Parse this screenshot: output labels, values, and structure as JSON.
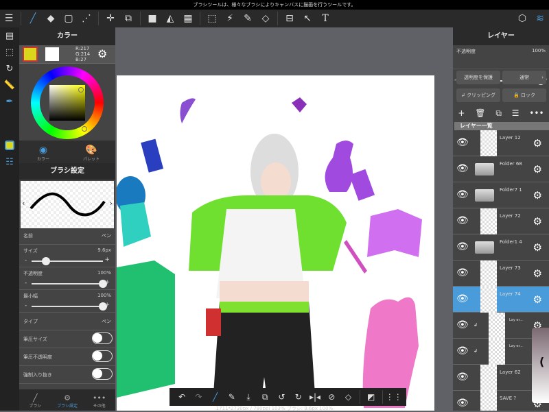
{
  "top_message": "ブラシツールは、様々なブラシによりキャンバスに描画を行うツールです。",
  "toolbar": {
    "icons": [
      "menu-icon",
      "brush-icon",
      "eraser-icon",
      "rectangle-icon",
      "dot-icon",
      "move-icon",
      "transform-icon",
      "fill-color-icon",
      "bucket-icon",
      "gradient-icon",
      "select-icon",
      "magic-wand-icon",
      "select-pen-icon",
      "select-eraser-icon",
      "divide-icon",
      "operation-icon",
      "text-icon"
    ],
    "right_icons": [
      "materials-icon",
      "layers-icon"
    ]
  },
  "color_panel": {
    "title": "カラー",
    "r": "R:217",
    "g": "G:214",
    "b": "B:27",
    "primary": "#d9d61b",
    "tab_color": "カラー",
    "tab_palette": "パレット"
  },
  "brush_settings": {
    "title": "ブラシ設定",
    "name_label": "名前",
    "name_value": "ペン",
    "size_label": "サイズ",
    "size_value": "9.6px",
    "size_fraction": 0.2,
    "opacity_label": "不透明度",
    "opacity_value": "100%",
    "opacity_fraction": 1.0,
    "min_label": "最小幅",
    "min_value": "100%",
    "min_fraction": 1.0,
    "type_label": "タイプ",
    "type_value": "ペン",
    "toggles": [
      {
        "label": "筆圧サイズ",
        "on": false
      },
      {
        "label": "筆圧不透明度",
        "on": false
      },
      {
        "label": "強制入り抜き",
        "on": false
      }
    ],
    "minus": "-",
    "plus": "+"
  },
  "left_bottom_tabs": [
    {
      "label": "ブラシ"
    },
    {
      "label": "ブラシ設定"
    },
    {
      "label": "その他"
    }
  ],
  "layer_panel": {
    "title": "レイヤー",
    "opacity_label": "不透明度",
    "opacity_value": "100%",
    "opacity_fraction": 1.0,
    "protect_alpha": "透明度を保護",
    "blend_mode": "通常",
    "clipping": "クリッピング",
    "lock": "ロック",
    "list_title": "レイヤー一覧",
    "layers": [
      {
        "name": "Layer 12",
        "type": "layer"
      },
      {
        "name": "Folder 68",
        "type": "folder"
      },
      {
        "name": "Folder7 1",
        "type": "folder"
      },
      {
        "name": "Layer 72",
        "type": "layer"
      },
      {
        "name": "Folder1 4",
        "type": "folder"
      },
      {
        "name": "Layer 73",
        "type": "layer"
      },
      {
        "name": "Layer 74",
        "type": "layer",
        "selected": true
      },
      {
        "name": "Lay er...",
        "type": "clip"
      },
      {
        "name": "Lay er...",
        "type": "clip"
      },
      {
        "name": "Layer 62",
        "type": "layer"
      },
      {
        "name": "SAVE ?",
        "type": "layer"
      }
    ]
  },
  "status": "1711*2730px / 780ppi 103% ブラシ: 9.6px 100%",
  "accent": "#4a9bd9"
}
